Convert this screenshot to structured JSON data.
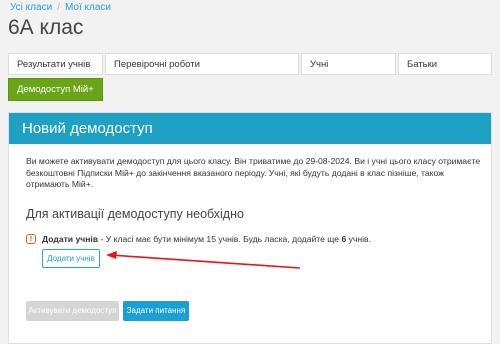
{
  "breadcrumb": {
    "items": [
      "Усі класи",
      "Мої класи"
    ],
    "separator": "/"
  },
  "page_title": "6А клас",
  "tabs": [
    {
      "label": "Результати учнів"
    },
    {
      "label": "Перевірочні роботи"
    },
    {
      "label": "Учні"
    },
    {
      "label": "Батьки"
    },
    {
      "label": "Демодоступ Мій+",
      "active": true
    }
  ],
  "panel": {
    "header": "Новий демодоступ",
    "text": "Ви можете активувати демодоступ для цього класу. Він триватиме до 29-08-2024. Ви і учні цього класу отримаєте безкоштовні Підписки Мій+ до закінчення вказаного періоду. Учні, які будуть додані в клас пізніше, також отримають Мій+.",
    "section_title": "Для активації демодоступу необхідно",
    "requirement": {
      "icon": "warning-icon",
      "bold": "Додати учнів",
      "text_before": " - У класі має бути мінімум 15 учнів. Будь ласка, додайте ще ",
      "count": "6",
      "text_after": " учнів."
    },
    "add_students_button": "Додати учнів",
    "activate_button": "Активувати демодоступ",
    "ask_question_button": "Задати питання"
  },
  "colors": {
    "header_blue": "#1fa0c5",
    "active_tab_green": "#6aa517",
    "arrow_red": "#e8141a",
    "warning_orange": "#e25b1f",
    "primary_blue": "#1a9fd6"
  }
}
